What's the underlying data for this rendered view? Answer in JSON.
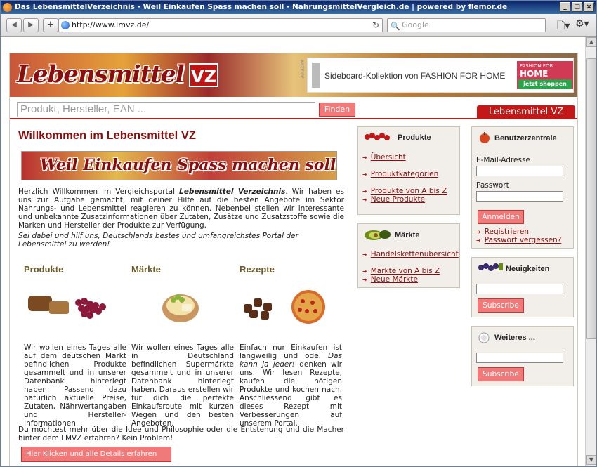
{
  "window": {
    "title": "Das LebensmittelVerzeichnis - Weil Einkaufen Spass machen soll - NahrungsmittelVergleich.de | powered by flemor.de"
  },
  "browser": {
    "url": "http://www.lmvz.de/",
    "search_placeholder": "Google"
  },
  "site": {
    "logo_text": "Lebensmittel",
    "logo_badge": "VZ",
    "ad": {
      "label": "ANZEIGE",
      "text": "Sideboard-Kollektion von FASHION FOR HOME",
      "brand_small": "FASHION FOR",
      "brand_big": "HOME",
      "cta": "jetzt shoppen"
    },
    "search_placeholder": "Produkt, Hersteller, EAN ...",
    "search_button": "Finden",
    "tab": "Lebensmittel VZ"
  },
  "main": {
    "heading": "Willkommen im Lebensmittel VZ",
    "banner_text": "Weil Einkaufen Spass machen soll",
    "intro_a": "Herzlich Willkommen im Vergleichsportal ",
    "intro_b": "Lebensmittel Verzeichnis",
    "intro_c": ". Wir haben es uns zur Aufgabe gemacht, mit deiner Hilfe auf die besten Angebote im Sektor Nahrungs- und Lebensmittel reagieren zu können. Nebenbei stellen wir interessante und unbekannte Zusatzinformationen über Zutaten, Zusätze und Zusatzstoffe sowie die Marken und Hersteller der Produkte zur Verfügung.",
    "intro2": "Sei dabei und hilf uns, Deutschlands bestes und umfangreichstes Portal der Lebensmittel zu werden!",
    "columns": [
      {
        "title": "Produkte",
        "text": "Wir wollen eines Tages alle auf dem deutschen Markt befindlichen Produkte gesammelt und in unserer Datenbank hinterlegt haben. Passend dazu natürlich aktuelle Preise, Zutaten, Nährwertangaben und Hersteller-Informationen."
      },
      {
        "title": "Märkte",
        "text": "Wir wollen eines Tages alle in Deutschland befindlichen Supermärkte gesammelt und in unserer Datenbank hinterlegt haben. Daraus erstellen wir für dich die perfekte Einkaufsroute mit kurzen Wegen und den besten Angeboten."
      },
      {
        "title": "Rezepte",
        "text_a": "Einfach nur Einkaufen ist langweilig und öde. ",
        "text_b": "Das kann ja jeder!",
        "text_c": " denken wir uns. Wir lesen Rezepte, kaufen die nötigen Produkte und kochen nach. Anschliessend gibt es dieses Rezept mit Verbesserungen auf unserem Portal."
      }
    ],
    "bottom_text": "Du möchtest mehr über die Idee und Philosophie oder die Entstehung und die Macher hinter dem LMVZ erfahren? Kein Problem!",
    "bottom_button": "Hier Klicken und alle Details erfahren"
  },
  "mid": {
    "produkte": {
      "title": "Produkte",
      "links": [
        "Übersicht",
        "Produktkategorien",
        "Produkte von A bis Z",
        "Neue Produkte"
      ]
    },
    "maerkte": {
      "title": "Märkte",
      "links": [
        "Handelskettenübersicht",
        "Märkte von A bis Z",
        "Neue Märkte"
      ]
    }
  },
  "right": {
    "login": {
      "title": "Benutzerzentrale",
      "email_label": "E-Mail-Adresse",
      "password_label": "Passwort",
      "button": "Anmelden",
      "register": "Registrieren",
      "forgot": "Passwort vergessen?"
    },
    "news": {
      "title": "Neuigkeiten",
      "button": "Subscribe"
    },
    "more": {
      "title": "Weiteres ...",
      "button": "Subscribe"
    }
  }
}
